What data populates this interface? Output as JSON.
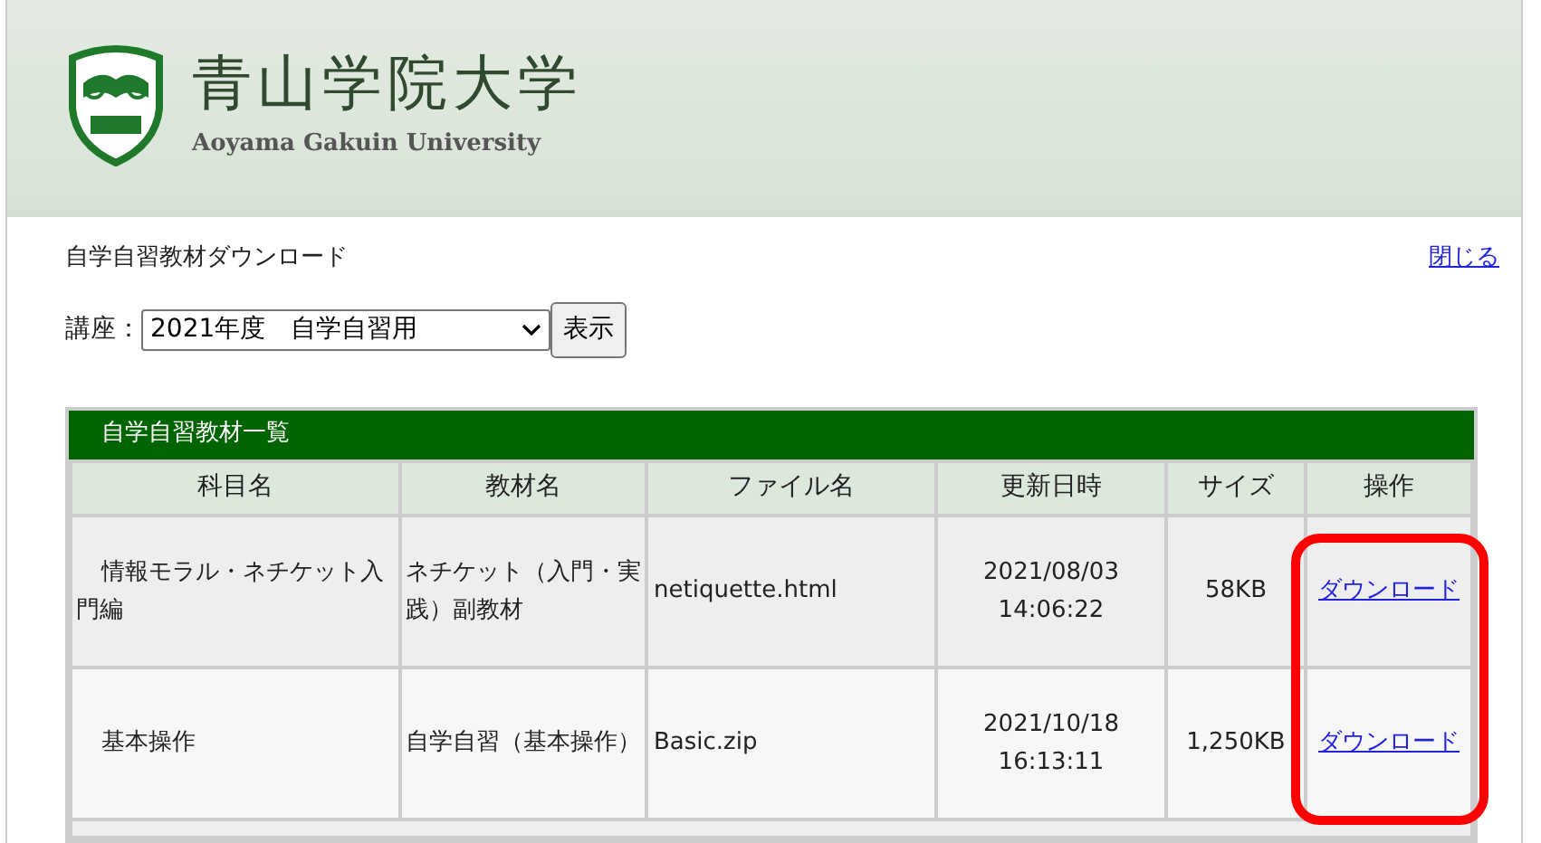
{
  "header": {
    "title": "青山学院大学",
    "subtitle": "Aoyama Gakuin University"
  },
  "page_heading": "自学自習教材ダウンロード",
  "close_link": "閉じる",
  "course": {
    "label": "講座：",
    "value": "2021年度　自学自習用",
    "button": "表示"
  },
  "table": {
    "caption": "自学自習教材一覧",
    "columns": [
      "科目名",
      "教材名",
      "ファイル名",
      "更新日時",
      "サイズ",
      "操作"
    ],
    "rows": [
      {
        "subject": "情報モラル・ネチケット入門編",
        "material": "ネチケット（入門・実践）副教材",
        "file": "netiquette.html",
        "updated": [
          "2021/08/03",
          "14:06:22"
        ],
        "size": "58KB",
        "action": "ダウンロード"
      },
      {
        "subject": "基本操作",
        "material": "自学自習（基本操作）",
        "file": "Basic.zip",
        "updated": [
          "2021/10/18",
          "16:13:11"
        ],
        "size": "1,250KB",
        "action": "ダウンロード"
      }
    ]
  },
  "annotation": {
    "kind": "highlight"
  }
}
